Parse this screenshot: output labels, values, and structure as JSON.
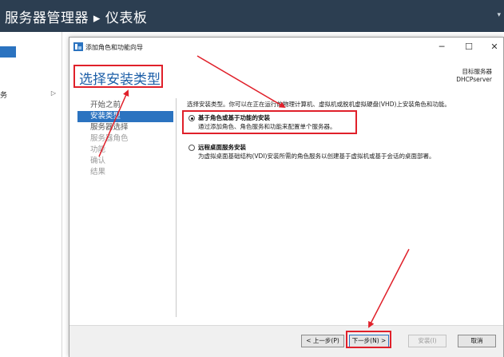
{
  "server_manager": {
    "title": "服务器管理器 ▸ 仪表板",
    "nav_item_partial": "务",
    "nav_item_arrow": "▷"
  },
  "wizard": {
    "window_title": "添加角色和功能向导",
    "controls": {
      "minimize": "─",
      "maximize": "☐",
      "close": "✕"
    },
    "heading": "选择安装类型",
    "target_label": "目标服务器",
    "target_server": "DHCPserver",
    "steps": [
      {
        "label": "开始之前",
        "state": "done"
      },
      {
        "label": "安装类型",
        "state": "active"
      },
      {
        "label": "服务器选择",
        "state": "next"
      },
      {
        "label": "服务器角色",
        "state": "disabled"
      },
      {
        "label": "功能",
        "state": "disabled"
      },
      {
        "label": "确认",
        "state": "disabled"
      },
      {
        "label": "结果",
        "state": "disabled"
      }
    ],
    "intro": "选择安装类型。你可以在正在运行的物理计算机、虚拟机或脱机虚拟硬盘(VHD)上安装角色和功能。",
    "options": [
      {
        "title": "基于角色或基于功能的安装",
        "description": "通过添加角色、角色服务和功能来配置单个服务器。",
        "checked": true
      },
      {
        "title": "远程桌面服务安装",
        "description": "为虚拟桌面基础结构(VDI)安装所需的角色服务以创建基于虚拟机或基于会话的桌面部署。",
        "checked": false
      }
    ],
    "buttons": {
      "previous": "< 上一步(P)",
      "next": "下一步(N) >",
      "install": "安装(I)",
      "cancel": "取消"
    }
  },
  "colors": {
    "header_bg": "#2c3e51",
    "accent": "#2b73c0",
    "annotation": "#e0202a",
    "heading_text": "#1d5fa8"
  }
}
